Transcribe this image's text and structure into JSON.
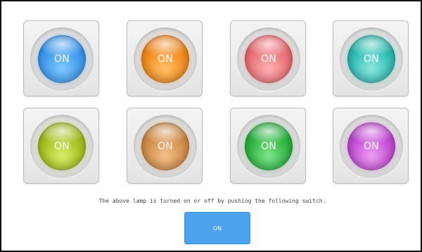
{
  "lamps": [
    {
      "label": "ON",
      "color": "blue",
      "base": "#3d96ec",
      "light": "#7cc8ff",
      "dark": "#1d6cc2"
    },
    {
      "label": "ON",
      "color": "orange",
      "base": "#f08a1c",
      "light": "#ffc06a",
      "dark": "#c8630a"
    },
    {
      "label": "ON",
      "color": "red",
      "base": "#e86e74",
      "light": "#ffb0b2",
      "dark": "#c5464d"
    },
    {
      "label": "ON",
      "color": "teal",
      "base": "#2cbab1",
      "light": "#8ee6df",
      "dark": "#148d86"
    },
    {
      "label": "ON",
      "color": "olive",
      "base": "#a3bf1c",
      "light": "#d9ec6c",
      "dark": "#7a9410"
    },
    {
      "label": "ON",
      "color": "tan",
      "base": "#cf8a45",
      "light": "#f2c08a",
      "dark": "#a5642a"
    },
    {
      "label": "ON",
      "color": "green",
      "base": "#28b23d",
      "light": "#7fe48a",
      "dark": "#168a28"
    },
    {
      "label": "ON",
      "color": "purple",
      "base": "#c14ad2",
      "light": "#ec9ef5",
      "dark": "#952aa6"
    }
  ],
  "instruction": "The above lamp is turned on or off by pushing the following switch.",
  "switch": {
    "label": "ON",
    "color": "#4aa3ec"
  }
}
